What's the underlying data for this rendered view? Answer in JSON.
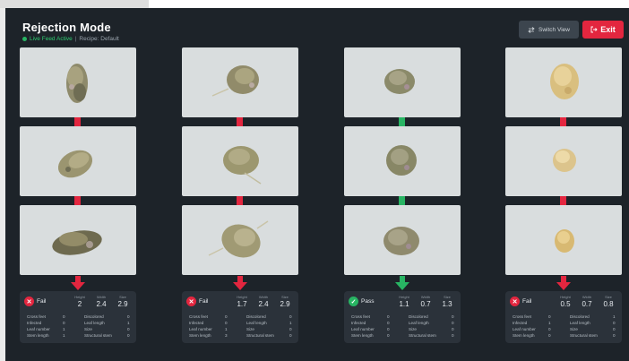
{
  "header": {
    "title": "Rejection Mode",
    "status": "Live Feed Active",
    "separator": "|",
    "recipe": "Recipe: Default",
    "switch_view_label": "Switch View",
    "exit_label": "Exit"
  },
  "colors": {
    "background": "#1d2329",
    "fail": "#e3263f",
    "pass": "#28b463",
    "card": "#2b323a",
    "photo_bg": "#d9ddde"
  },
  "icons": {
    "switch": "swap-arrows-icon",
    "exit": "exit-arrow-icon",
    "fail": "x-circle-icon",
    "pass": "check-circle-icon"
  },
  "metric_labels": [
    "Height",
    "Width",
    "Size"
  ],
  "detail_labels_left": [
    "Cross feet",
    "Infected",
    "Leaf number",
    "Stem length"
  ],
  "detail_labels_right": [
    "Discolored",
    "Leaf length",
    "Size",
    "Structural stem"
  ],
  "lanes": [
    {
      "status": "Fail",
      "metrics": [
        "2",
        "2.4",
        "2.9"
      ],
      "left_values": [
        "0",
        "0",
        "1",
        "1"
      ],
      "right_values": [
        "0",
        "1",
        "0",
        "0"
      ]
    },
    {
      "status": "Fail",
      "metrics": [
        "1.7",
        "2.4",
        "2.9"
      ],
      "left_values": [
        "0",
        "0",
        "1",
        "3"
      ],
      "right_values": [
        "0",
        "1",
        "0",
        "0"
      ]
    },
    {
      "status": "Pass",
      "metrics": [
        "1.1",
        "0.7",
        "1.3"
      ],
      "left_values": [
        "0",
        "0",
        "0",
        "0"
      ],
      "right_values": [
        "0",
        "0",
        "0",
        "0"
      ]
    },
    {
      "status": "Fail",
      "metrics": [
        "0.5",
        "0.7",
        "0.8"
      ],
      "left_values": [
        "0",
        "1",
        "0",
        "0"
      ],
      "right_values": [
        "1",
        "0",
        "0",
        "0"
      ]
    }
  ]
}
